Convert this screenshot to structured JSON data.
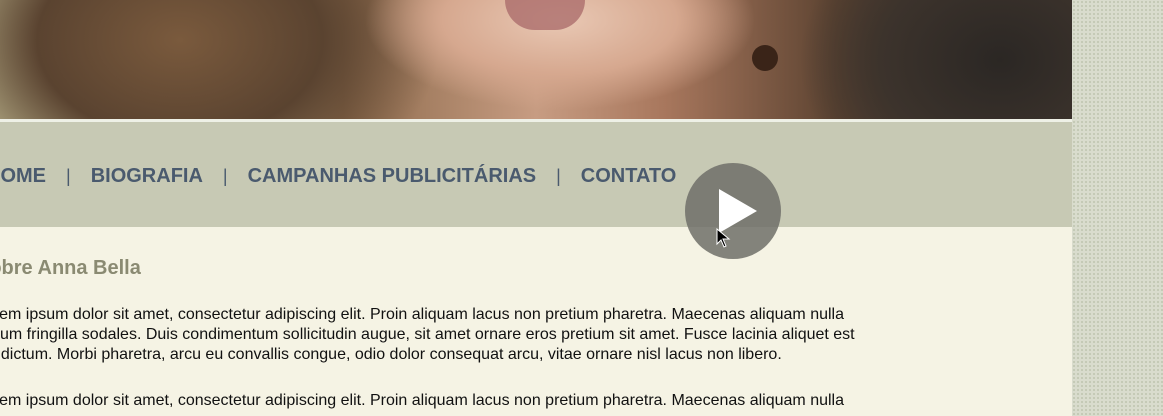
{
  "nav": {
    "items": [
      {
        "label": "HOME"
      },
      {
        "label": "BIOGRAFIA"
      },
      {
        "label": "CAMPANHAS PUBLICITÁRIAS"
      },
      {
        "label": "CONTATO"
      }
    ],
    "separator": "|"
  },
  "content": {
    "heading": "Sobre Anna Bella",
    "paragraphs": [
      [
        "Lorem ipsum dolor sit amet, consectetur adipiscing elit. Proin aliquam lacus non pretium pharetra. Maecenas aliquam nulla",
        "rutrum fringilla sodales. Duis condimentum sollicitudin augue, sit amet ornare eros pretium sit amet. Fusce lacinia aliquet est",
        "vel dictum. Morbi pharetra, arcu eu convallis congue, odio dolor consequat arcu, vitae ornare nisl lacus non libero."
      ],
      [
        "Lorem ipsum dolor sit amet, consectetur adipiscing elit. Proin aliquam lacus non pretium pharetra. Maecenas aliquam nulla"
      ]
    ]
  },
  "video": {
    "icon": "play-icon"
  },
  "colors": {
    "nav_bg": "#c7c9b4",
    "nav_text": "#4a5a6e",
    "content_bg": "#f5f3e4",
    "heading": "#8a8a72"
  }
}
